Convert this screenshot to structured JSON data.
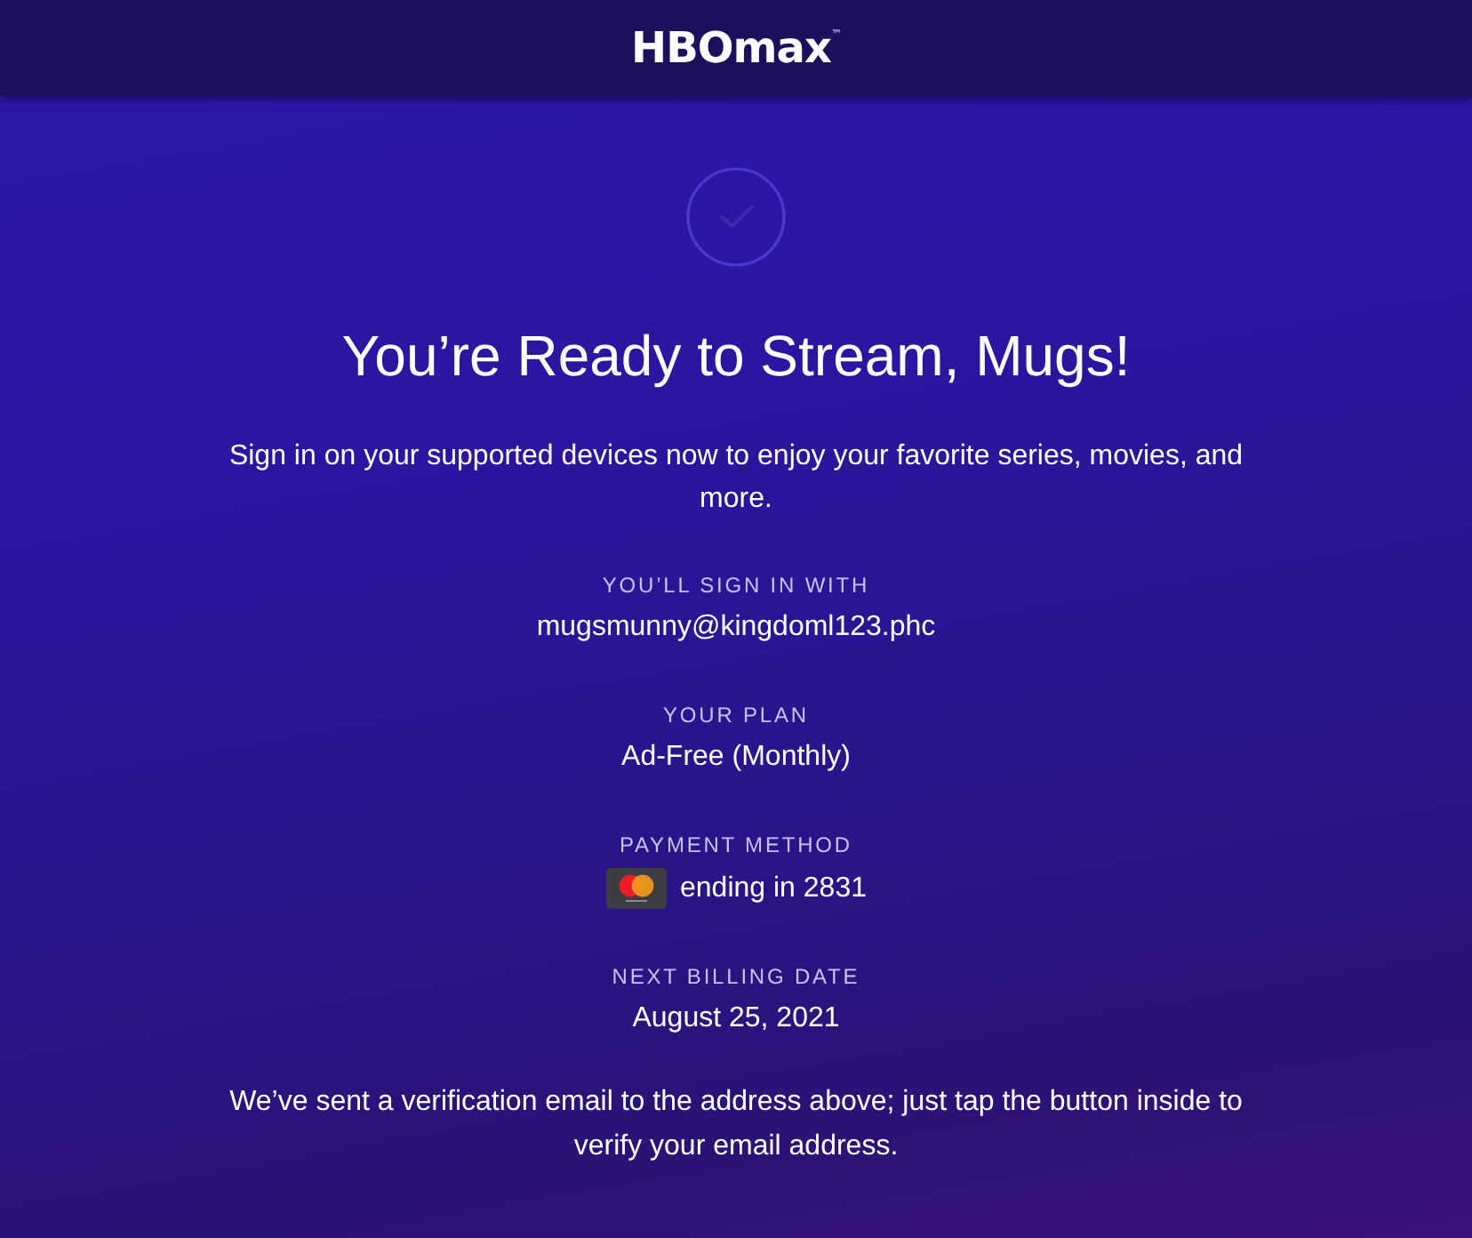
{
  "header": {
    "logo": "HBOmax$^{™}$"
  },
  "confirmation": {
    "title": "You’re Ready to Stream, Mugs!",
    "message": "Sign in on your supported devices now to enjoy your favorite series, movies, and more."
  },
  "details": [
    {
      "kind": "text",
      "label": "YOU’LL SIGN IN WITH",
      "value": "mugsmunny@kingdoml123.phc"
    },
    {
      "kind": "text",
      "label": "YOUR PLAN",
      "value": "Ad-Free (Monthly)"
    },
    {
      "kind": "card",
      "label": "PAYMENT METHOD",
      "value": "ending in 2831"
    },
    {
      "kind": "text",
      "label": "NEXT BILLING DATE",
      "value": "August 25, 2021"
    }
  ],
  "footer_note": "We’ve sent a verification email to the address above; just tap the button inside to verify your email address."
}
